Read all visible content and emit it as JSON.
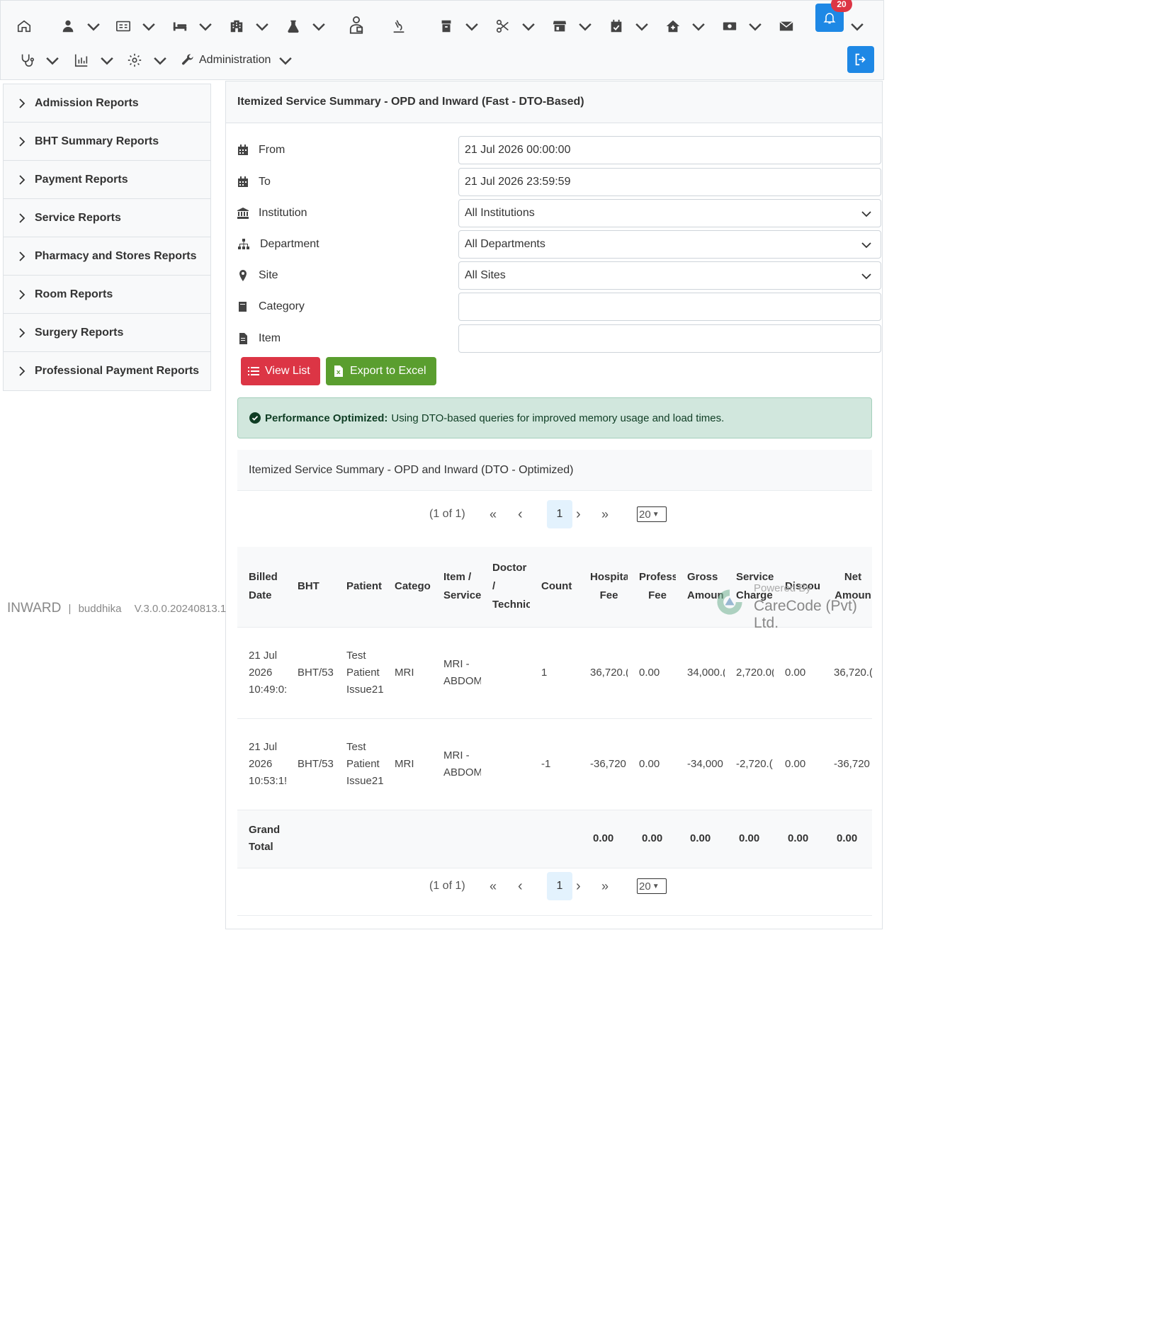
{
  "nav": {
    "notification_count": "20",
    "admin_label": "Administration"
  },
  "sidebar": {
    "items": [
      {
        "label": "Admission Reports"
      },
      {
        "label": "BHT Summary Reports"
      },
      {
        "label": "Payment Reports"
      },
      {
        "label": "Service Reports"
      },
      {
        "label": "Pharmacy and Stores Reports"
      },
      {
        "label": "Room Reports"
      },
      {
        "label": "Surgery Reports"
      },
      {
        "label": "Professional Payment Reports"
      }
    ]
  },
  "panel": {
    "title": "Itemized Service Summary - OPD and Inward (Fast - DTO-Based)",
    "form": {
      "from_label": "From",
      "from_value": "21 Jul 2026 00:00:00",
      "to_label": "To",
      "to_value": "21 Jul 2026 23:59:59",
      "institution_label": "Institution",
      "institution_value": "All Institutions",
      "department_label": "Department",
      "department_value": "All Departments",
      "site_label": "Site",
      "site_value": "All Sites",
      "category_label": "Category",
      "category_value": "",
      "item_label": "Item",
      "item_value": ""
    },
    "buttons": {
      "view_list": "View List",
      "export_excel": "Export to Excel"
    },
    "alert": {
      "strong": "Performance Optimized:",
      "text": "Using DTO-based queries for improved memory usage and load times."
    },
    "table_title": "Itemized Service Summary - OPD and Inward (DTO - Optimized)",
    "pager": {
      "info": "(1 of 1)",
      "first": "«",
      "prev": "‹",
      "current": "1",
      "next": "›",
      "last": "»",
      "rows": "20"
    }
  },
  "table": {
    "headers": [
      "Billed Date",
      "BHT",
      "Patient",
      "Catego",
      "Item / Service",
      "Doctor / Technic",
      "Count",
      "Hospita Fee",
      "Profess Fee",
      "Gross Amoun",
      "Service Charge",
      "Discou",
      "Net Amoun"
    ],
    "rows": [
      {
        "date": "21 Jul 2026 10:49:0:",
        "bht": "BHT/53",
        "patient": "Test Patient Issue21",
        "category": "MRI",
        "item": "MRI - ABDOM",
        "doctor": "",
        "count": "1",
        "hospital_fee": "36,720.(",
        "prof_fee": "0.00",
        "gross": "34,000.(",
        "service_charge": "2,720.0(",
        "discount": "0.00",
        "net": "36,720.("
      },
      {
        "date": "21 Jul 2026 10:53:1!",
        "bht": "BHT/53",
        "patient": "Test Patient Issue21",
        "category": "MRI",
        "item": "MRI - ABDOM",
        "doctor": "",
        "count": "-1",
        "hospital_fee": "-36,720",
        "prof_fee": "0.00",
        "gross": "-34,000",
        "service_charge": "-2,720.(",
        "discount": "0.00",
        "net": "-36,720"
      }
    ],
    "total": {
      "label": "Grand Total",
      "hospital_fee": "0.00",
      "prof_fee": "0.00",
      "gross": "0.00",
      "service_charge": "0.00",
      "discount": "0.00",
      "net": "0.00"
    }
  },
  "footer": {
    "app": "INWARD",
    "separator": "|",
    "user": "buddhika",
    "version": "V.3.0.0.20240813.1",
    "powered_by": "Powered By",
    "company": "CareCode (Pvt) Ltd."
  }
}
